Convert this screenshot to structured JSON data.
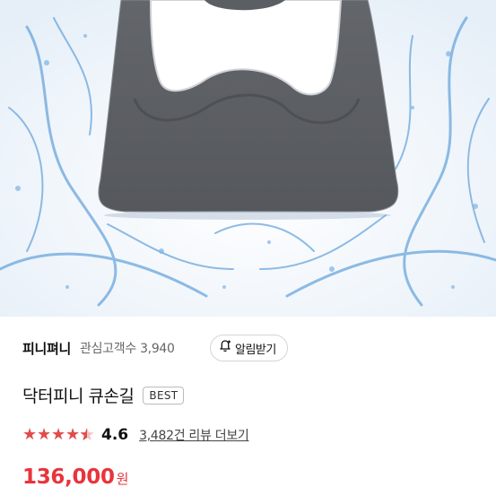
{
  "product_image": {
    "description_icon": "product-photo"
  },
  "seller": {
    "name": "피니펴니",
    "favorite_label": "관심고객수 3,940"
  },
  "alarm_button": {
    "label": "알림받기",
    "icon": "bell-plus-icon"
  },
  "product": {
    "title": "닥터피니 큐손길",
    "badge": "BEST"
  },
  "rating": {
    "value": "4.6",
    "stars": 4.5,
    "review_label": "3,482건 리뷰 더보기"
  },
  "price": {
    "amount": "136,000",
    "currency": "원"
  },
  "colors": {
    "price": "#e8343b",
    "star": "#e04c4c"
  }
}
